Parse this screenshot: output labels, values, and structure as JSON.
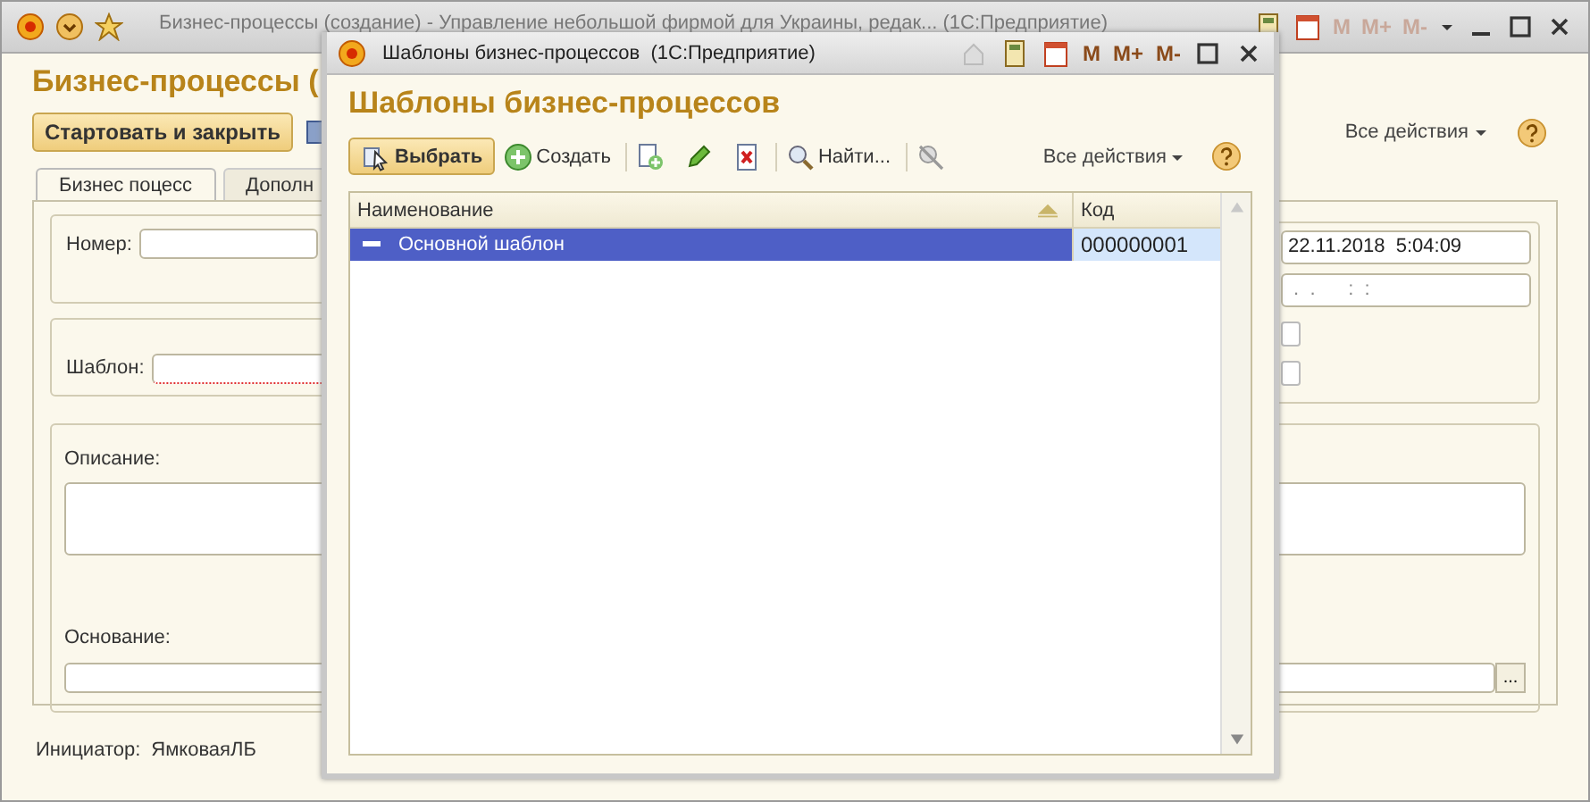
{
  "main_window": {
    "title": "Бизнес-процессы (создание) - Управление небольшой фирмой для Украины, редак... (1С:Предприятие)",
    "title_memory": [
      "M",
      "M+",
      "M-"
    ],
    "heading": "Бизнес-процессы (",
    "start_button": "Стартовать и закрыть",
    "all_actions": "Все действия",
    "tabs": [
      {
        "label": "Бизнес поцесс",
        "selected": true
      },
      {
        "label": "Дополн",
        "selected": false
      }
    ],
    "number_label": "Номер:",
    "date_value": "22.11.2018  5:04:09",
    "date_mask": " .  .      :  :",
    "checkboxes": [
      {
        "checked": false
      },
      {
        "checked": false
      }
    ],
    "template_label": "Шаблон:",
    "description_label": "Описание:",
    "basis_label": "Основание:",
    "basis_button": "...",
    "initiator_label": "Инициатор:",
    "initiator_value": "ЯмковаяЛБ"
  },
  "dialog": {
    "title": "Шаблоны бизнес-процессов  (1С:Предприятие)",
    "title_memory": [
      "M",
      "M+",
      "M-"
    ],
    "heading": "Шаблоны бизнес-процессов",
    "toolbar": [
      {
        "kind": "select",
        "label": "Выбрать"
      },
      {
        "kind": "create",
        "label": "Создать"
      },
      {
        "kind": "copy"
      },
      {
        "kind": "edit"
      },
      {
        "kind": "delete"
      },
      {
        "kind": "find",
        "label": "Найти..."
      },
      {
        "kind": "cancel-find"
      }
    ],
    "all_actions": "Все действия",
    "columns": [
      "Наименование",
      "Код"
    ],
    "rows": [
      {
        "name": "Основной шаблон",
        "code": "000000001",
        "selected": true
      }
    ]
  }
}
